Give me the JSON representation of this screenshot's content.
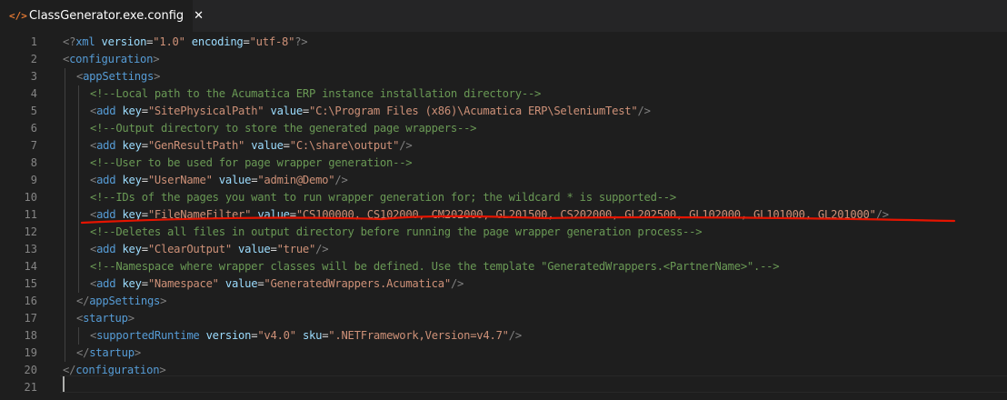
{
  "tab": {
    "icon": "xml-file-icon",
    "icon_glyph": "</>",
    "title": "ClassGenerator.exe.config",
    "close_glyph": "✕"
  },
  "editor": {
    "lines": [
      {
        "n": "1",
        "indent": 0,
        "tokens": [
          [
            "punc",
            "<?"
          ],
          [
            "tag",
            "xml"
          ],
          [
            "sp",
            " "
          ],
          [
            "attr",
            "version"
          ],
          [
            "eq",
            "="
          ],
          [
            "str",
            "\"1.0\""
          ],
          [
            "sp",
            " "
          ],
          [
            "attr",
            "encoding"
          ],
          [
            "eq",
            "="
          ],
          [
            "str",
            "\"utf-8\""
          ],
          [
            "punc",
            "?>"
          ]
        ]
      },
      {
        "n": "2",
        "indent": 0,
        "tokens": [
          [
            "punc",
            "<"
          ],
          [
            "tag",
            "configuration"
          ],
          [
            "punc",
            ">"
          ]
        ]
      },
      {
        "n": "3",
        "indent": 1,
        "tokens": [
          [
            "punc",
            "<"
          ],
          [
            "tag",
            "appSettings"
          ],
          [
            "punc",
            ">"
          ]
        ]
      },
      {
        "n": "4",
        "indent": 2,
        "tokens": [
          [
            "cmt",
            "<!--Local path to the Acumatica ERP instance installation directory-->"
          ]
        ]
      },
      {
        "n": "5",
        "indent": 2,
        "tokens": [
          [
            "punc",
            "<"
          ],
          [
            "tag",
            "add"
          ],
          [
            "sp",
            " "
          ],
          [
            "attr",
            "key"
          ],
          [
            "eq",
            "="
          ],
          [
            "str",
            "\"SitePhysicalPath\""
          ],
          [
            "sp",
            " "
          ],
          [
            "attr",
            "value"
          ],
          [
            "eq",
            "="
          ],
          [
            "str",
            "\"C:\\Program Files (x86)\\Acumatica ERP\\SeleniumTest\""
          ],
          [
            "punc",
            "/>"
          ]
        ]
      },
      {
        "n": "6",
        "indent": 2,
        "tokens": [
          [
            "cmt",
            "<!--Output directory to store the generated page wrappers-->"
          ]
        ]
      },
      {
        "n": "7",
        "indent": 2,
        "tokens": [
          [
            "punc",
            "<"
          ],
          [
            "tag",
            "add"
          ],
          [
            "sp",
            " "
          ],
          [
            "attr",
            "key"
          ],
          [
            "eq",
            "="
          ],
          [
            "str",
            "\"GenResultPath\""
          ],
          [
            "sp",
            " "
          ],
          [
            "attr",
            "value"
          ],
          [
            "eq",
            "="
          ],
          [
            "str",
            "\"C:\\share\\output\""
          ],
          [
            "punc",
            "/>"
          ]
        ]
      },
      {
        "n": "8",
        "indent": 2,
        "tokens": [
          [
            "cmt",
            "<!--User to be used for page wrapper generation-->"
          ]
        ]
      },
      {
        "n": "9",
        "indent": 2,
        "tokens": [
          [
            "punc",
            "<"
          ],
          [
            "tag",
            "add"
          ],
          [
            "sp",
            " "
          ],
          [
            "attr",
            "key"
          ],
          [
            "eq",
            "="
          ],
          [
            "str",
            "\"UserName\""
          ],
          [
            "sp",
            " "
          ],
          [
            "attr",
            "value"
          ],
          [
            "eq",
            "="
          ],
          [
            "str",
            "\"admin@Demo\""
          ],
          [
            "punc",
            "/>"
          ]
        ]
      },
      {
        "n": "10",
        "indent": 2,
        "tokens": [
          [
            "cmt",
            "<!--IDs of the pages you want to run wrapper generation for; the wildcard * is supported-->"
          ]
        ]
      },
      {
        "n": "11",
        "indent": 2,
        "tokens": [
          [
            "punc",
            "<"
          ],
          [
            "tag",
            "add"
          ],
          [
            "sp",
            " "
          ],
          [
            "attr",
            "key"
          ],
          [
            "eq",
            "="
          ],
          [
            "str",
            "\"FileNameFilter\""
          ],
          [
            "sp",
            " "
          ],
          [
            "attr",
            "value"
          ],
          [
            "eq",
            "="
          ],
          [
            "str",
            "\"CS100000, CS102000, CM202000, GL201500, CS202000, GL202500, GL102000, GL101000, GL201000\""
          ],
          [
            "punc",
            "/>"
          ]
        ]
      },
      {
        "n": "12",
        "indent": 2,
        "tokens": [
          [
            "cmt",
            "<!--Deletes all files in output directory before running the page wrapper generation process-->"
          ]
        ]
      },
      {
        "n": "13",
        "indent": 2,
        "tokens": [
          [
            "punc",
            "<"
          ],
          [
            "tag",
            "add"
          ],
          [
            "sp",
            " "
          ],
          [
            "attr",
            "key"
          ],
          [
            "eq",
            "="
          ],
          [
            "str",
            "\"ClearOutput\""
          ],
          [
            "sp",
            " "
          ],
          [
            "attr",
            "value"
          ],
          [
            "eq",
            "="
          ],
          [
            "str",
            "\"true\""
          ],
          [
            "punc",
            "/>"
          ]
        ]
      },
      {
        "n": "14",
        "indent": 2,
        "tokens": [
          [
            "cmt",
            "<!--Namespace where wrapper classes will be defined. Use the template \"GeneratedWrappers.<PartnerName>\".-->"
          ]
        ]
      },
      {
        "n": "15",
        "indent": 2,
        "tokens": [
          [
            "punc",
            "<"
          ],
          [
            "tag",
            "add"
          ],
          [
            "sp",
            " "
          ],
          [
            "attr",
            "key"
          ],
          [
            "eq",
            "="
          ],
          [
            "str",
            "\"Namespace\""
          ],
          [
            "sp",
            " "
          ],
          [
            "attr",
            "value"
          ],
          [
            "eq",
            "="
          ],
          [
            "str",
            "\"GeneratedWrappers.Acumatica\""
          ],
          [
            "punc",
            "/>"
          ]
        ]
      },
      {
        "n": "16",
        "indent": 1,
        "tokens": [
          [
            "punc",
            "</"
          ],
          [
            "tag",
            "appSettings"
          ],
          [
            "punc",
            ">"
          ]
        ]
      },
      {
        "n": "17",
        "indent": 1,
        "tokens": [
          [
            "punc",
            "<"
          ],
          [
            "tag",
            "startup"
          ],
          [
            "punc",
            ">"
          ]
        ]
      },
      {
        "n": "18",
        "indent": 2,
        "tokens": [
          [
            "punc",
            "<"
          ],
          [
            "tag",
            "supportedRuntime"
          ],
          [
            "sp",
            " "
          ],
          [
            "attr",
            "version"
          ],
          [
            "eq",
            "="
          ],
          [
            "str",
            "\"v4.0\""
          ],
          [
            "sp",
            " "
          ],
          [
            "attr",
            "sku"
          ],
          [
            "eq",
            "="
          ],
          [
            "str",
            "\".NETFramework,Version=v4.7\""
          ],
          [
            "punc",
            "/>"
          ]
        ]
      },
      {
        "n": "19",
        "indent": 1,
        "tokens": [
          [
            "punc",
            "</"
          ],
          [
            "tag",
            "startup"
          ],
          [
            "punc",
            ">"
          ]
        ]
      },
      {
        "n": "20",
        "indent": 0,
        "tokens": [
          [
            "punc",
            "</"
          ],
          [
            "tag",
            "configuration"
          ],
          [
            "punc",
            ">"
          ]
        ]
      },
      {
        "n": "21",
        "indent": 0,
        "tokens": []
      }
    ]
  },
  "annotation": {
    "color": "#e51400",
    "target_line": "11"
  },
  "colors": {
    "background": "#1e1e1e",
    "tabbar": "#252526",
    "line_number": "#858585",
    "tag": "#569cd6",
    "attribute": "#9cdcfe",
    "string": "#ce9178",
    "comment": "#6a9955",
    "punctuation": "#808080"
  }
}
